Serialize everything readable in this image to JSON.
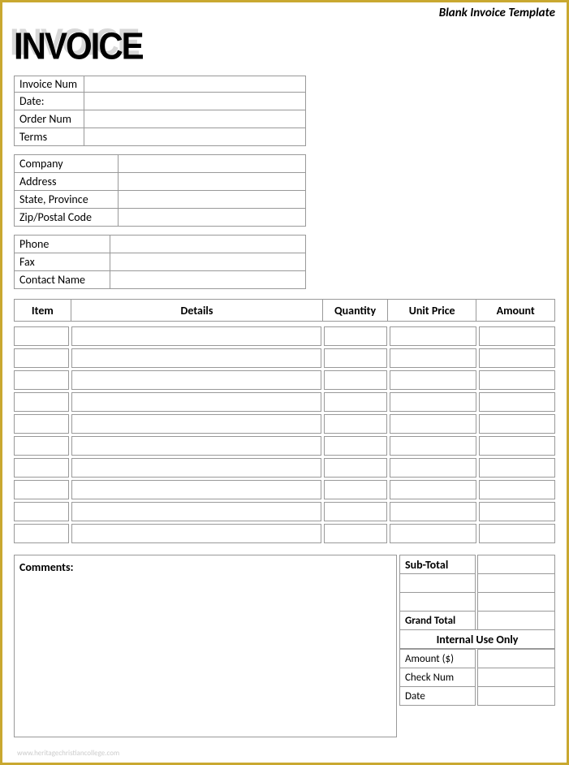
{
  "template_name": "Blank Invoice Template",
  "title": "INVOICE",
  "meta_fields": [
    {
      "label": "Invoice Num",
      "value": ""
    },
    {
      "label": "Date:",
      "value": ""
    },
    {
      "label": "Order Num",
      "value": ""
    },
    {
      "label": "Terms",
      "value": ""
    }
  ],
  "company_fields": [
    {
      "label": "Company",
      "value": ""
    },
    {
      "label": "Address",
      "value": ""
    },
    {
      "label": "State, Province",
      "value": ""
    },
    {
      "label": "Zip/Postal Code",
      "value": ""
    }
  ],
  "contact_fields": [
    {
      "label": "Phone",
      "value": ""
    },
    {
      "label": "Fax",
      "value": ""
    },
    {
      "label": "Contact Name",
      "value": ""
    }
  ],
  "item_headers": {
    "item": "Item",
    "details": "Details",
    "quantity": "Quantity",
    "unit_price": "Unit Price",
    "amount": "Amount"
  },
  "item_rows": [
    {
      "item": "",
      "details": "",
      "qty": "",
      "unit": "",
      "amount": ""
    },
    {
      "item": "",
      "details": "",
      "qty": "",
      "unit": "",
      "amount": ""
    },
    {
      "item": "",
      "details": "",
      "qty": "",
      "unit": "",
      "amount": ""
    },
    {
      "item": "",
      "details": "",
      "qty": "",
      "unit": "",
      "amount": ""
    },
    {
      "item": "",
      "details": "",
      "qty": "",
      "unit": "",
      "amount": ""
    },
    {
      "item": "",
      "details": "",
      "qty": "",
      "unit": "",
      "amount": ""
    },
    {
      "item": "",
      "details": "",
      "qty": "",
      "unit": "",
      "amount": ""
    },
    {
      "item": "",
      "details": "",
      "qty": "",
      "unit": "",
      "amount": ""
    },
    {
      "item": "",
      "details": "",
      "qty": "",
      "unit": "",
      "amount": ""
    },
    {
      "item": "",
      "details": "",
      "qty": "",
      "unit": "",
      "amount": ""
    }
  ],
  "comments_label": "Comments:",
  "comments_text": "",
  "totals": {
    "subtotal_label": "Sub-Total",
    "subtotal_value": "",
    "blank1": "",
    "blank2": "",
    "grand_label": "Grand Total",
    "grand_value": "",
    "internal_header": "Internal Use Only",
    "amount_label": "Amount ($)",
    "amount_value": "",
    "check_label": "Check Num",
    "check_value": "",
    "date_label": "Date",
    "date_value": ""
  },
  "watermark": "www.heritagechristiancollege.com"
}
